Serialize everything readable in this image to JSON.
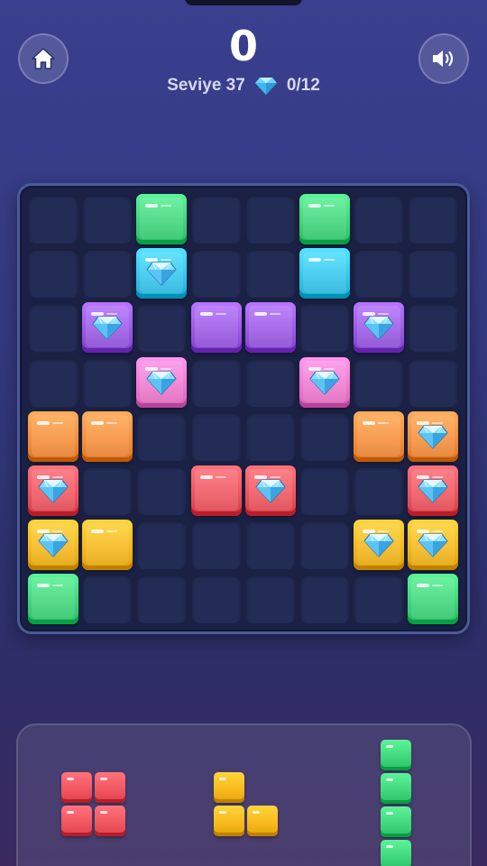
{
  "header": {
    "score": "0",
    "level_label": "Seviye 37",
    "gem_progress": "0/12",
    "home_icon": "home-icon",
    "sound_icon": "speaker-icon"
  },
  "colors": {
    "green": "#3fd67b",
    "cyan": "#35c6ee",
    "purple": "#9b59e6",
    "pink": "#f07ad0",
    "orange": "#f78f3b",
    "red": "#f0555f",
    "yellow": "#f7b81c"
  },
  "board": {
    "size": 8,
    "grid": [
      [
        "",
        "",
        "green",
        "",
        "",
        "green",
        "",
        ""
      ],
      [
        "",
        "",
        "cyan*",
        "",
        "",
        "cyan",
        "",
        ""
      ],
      [
        "",
        "purple*",
        "",
        "purple",
        "purple",
        "",
        "purple*",
        ""
      ],
      [
        "",
        "",
        "pink*",
        "",
        "",
        "pink*",
        "",
        ""
      ],
      [
        "orange",
        "orange",
        "",
        "",
        "",
        "",
        "orange",
        "orange*"
      ],
      [
        "red*",
        "",
        "",
        "red",
        "red*",
        "",
        "",
        "red*"
      ],
      [
        "yellow*",
        "yellow",
        "",
        "",
        "",
        "",
        "yellow*",
        "yellow*"
      ],
      [
        "green",
        "",
        "",
        "",
        "",
        "",
        "",
        "green"
      ]
    ],
    "legend": "* = block contains a diamond gem"
  },
  "tray": {
    "pieces": [
      {
        "color": "red",
        "cells": [
          [
            0,
            0
          ],
          [
            1,
            0
          ],
          [
            0,
            1
          ],
          [
            1,
            1
          ]
        ]
      },
      {
        "color": "yellow",
        "cells": [
          [
            0,
            0
          ],
          [
            0,
            1
          ],
          [
            1,
            1
          ]
        ]
      },
      {
        "color": "green",
        "cells": [
          [
            0,
            0
          ],
          [
            0,
            1
          ],
          [
            0,
            2
          ],
          [
            0,
            3
          ]
        ]
      }
    ]
  }
}
